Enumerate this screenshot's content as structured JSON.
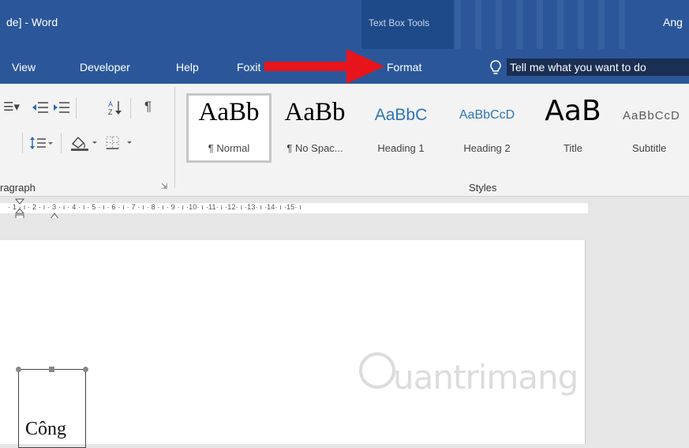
{
  "window": {
    "title_fragment": "de] - Word",
    "contextual_tab_group": "Text Box Tools",
    "user_fragment": "Ang"
  },
  "tabs": [
    {
      "label": "View"
    },
    {
      "label": "Developer"
    },
    {
      "label": "Help"
    },
    {
      "label": "Foxit Reader PDF"
    },
    {
      "label": "Format"
    }
  ],
  "tell_me": {
    "text": "Tell me what you want to do"
  },
  "paragraph_group": {
    "label": "ragraph",
    "row1_icons": [
      "decrease-indent-icon",
      "increase-indent-icon",
      "sort-icon",
      "pilcrow-icon"
    ],
    "row2_icons": [
      "line-spacing-icon",
      "shading-icon",
      "borders-icon"
    ]
  },
  "styles_group": {
    "label": "Styles",
    "items": [
      {
        "preview": "AaBb",
        "name": "¶ Normal",
        "color": "#000000"
      },
      {
        "preview": "AaBb",
        "name": "¶ No Spac...",
        "color": "#000000"
      },
      {
        "preview": "AaBbC",
        "name": "Heading 1",
        "color": "#2e74b5"
      },
      {
        "preview": "AaBbCcD",
        "name": "Heading 2",
        "color": "#2e74b5"
      },
      {
        "preview": "AaB",
        "name": "Title",
        "color": "#000000"
      },
      {
        "preview": "AaBbCcD",
        "name": "Subtitle",
        "color": "#595959"
      }
    ]
  },
  "ruler": {
    "text": "· 1 · ı · 2 · ı · 3 · ı · 4 · ı · 5 · ı · 6 · ı · 7 · ı · 8 · ı · 9 · ı ·10· ı ·11· ı ·12· ı ·13· ı ·14· ı ·15· ı"
  },
  "document": {
    "textbox_text": "Công",
    "watermark": "uantrimang"
  },
  "colors": {
    "title_bar": "#2b579a",
    "ribbon": "#f3f3f3",
    "arrow": "#e8141b"
  }
}
